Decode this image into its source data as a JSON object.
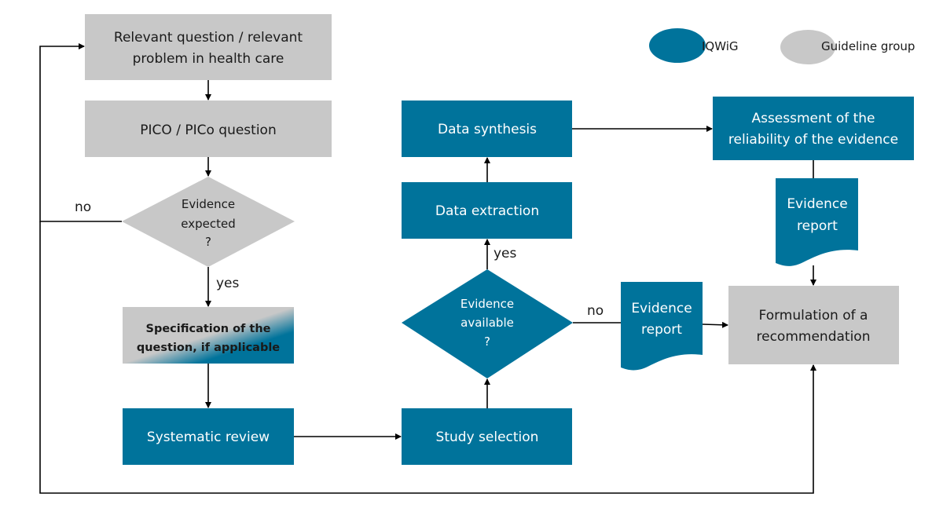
{
  "colors": {
    "iqwig": "#00739b",
    "guideline_group": "#c8c8c8"
  },
  "legend": [
    {
      "label": "IQWiG",
      "color": "#00739b"
    },
    {
      "label": "Guideline group",
      "color": "#c8c8c8"
    }
  ],
  "nodes": {
    "relevant_question": {
      "lines": [
        "Relevant question / relevant",
        "problem in health care"
      ],
      "owner": "Guideline group"
    },
    "pico": {
      "lines": [
        "PICO / PICo question"
      ],
      "owner": "Guideline group"
    },
    "evidence_expected": {
      "lines": [
        "Evidence",
        "expected",
        "?"
      ],
      "owner": "Guideline group"
    },
    "specification": {
      "lines": [
        "Specification of the",
        "question,  if applicable"
      ],
      "owner": "shared"
    },
    "systematic_review": {
      "lines": [
        "Systematic review"
      ],
      "owner": "IQWiG"
    },
    "study_selection": {
      "lines": [
        "Study selection"
      ],
      "owner": "IQWiG"
    },
    "evidence_available": {
      "lines": [
        "Evidence",
        "available",
        "?"
      ],
      "owner": "IQWiG"
    },
    "data_extraction": {
      "lines": [
        "Data extraction"
      ],
      "owner": "IQWiG"
    },
    "data_synthesis": {
      "lines": [
        "Data synthesis"
      ],
      "owner": "IQWiG"
    },
    "assessment": {
      "lines": [
        "Assessment of the",
        "reliability of the evidence"
      ],
      "owner": "IQWiG"
    },
    "evidence_report_top": {
      "lines": [
        "Evidence",
        "report"
      ],
      "owner": "IQWiG"
    },
    "evidence_report_left": {
      "lines": [
        "Evidence",
        "report"
      ],
      "owner": "IQWiG"
    },
    "formulation": {
      "lines": [
        "Formulation of a",
        "recommendation"
      ],
      "owner": "Guideline group"
    }
  },
  "edge_labels": {
    "expected_no": "no",
    "expected_yes": "yes",
    "available_yes": "yes",
    "available_no": "no"
  }
}
